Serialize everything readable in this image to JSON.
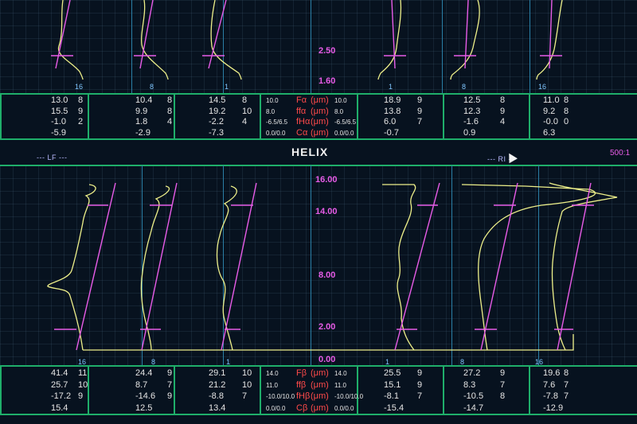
{
  "colors": {
    "background": "#07121f",
    "grid_line": "#1fae6a",
    "trace": "#eef08a",
    "reference": "#e85ce8",
    "marker": "#7fc6ff",
    "symbol": "#ff4a4a"
  },
  "profile": {
    "scale_upper": "2.50",
    "scale_lower": "1.60",
    "tooth_markers": [
      "16",
      "8",
      "1",
      "1",
      "8",
      "16"
    ],
    "rows": [
      {
        "l1": "13.0",
        "l1n": "8",
        "l2": "10.4",
        "l2n": "8",
        "l3": "14.5",
        "l3n": "8",
        "lt": "10.0",
        "sym": "Fα",
        "unit": "(μm)",
        "rt": "10.0",
        "r1": "18.9",
        "r1n": "9",
        "r2": "12.5",
        "r2n": "8",
        "r3": "11.0",
        "r3n": "8"
      },
      {
        "l1": "15.5",
        "l1n": "9",
        "l2": "9.9",
        "l2n": "8",
        "l3": "19.2",
        "l3n": "10",
        "lt": "8.0",
        "sym": "ffα",
        "unit": "(μm)",
        "rt": "8.0",
        "r1": "13.8",
        "r1n": "9",
        "r2": "12.3",
        "r2n": "9",
        "r3": "9.2",
        "r3n": "8"
      },
      {
        "l1": "-1.0",
        "l1n": "2",
        "l2": "1.8",
        "l2n": "4",
        "l3": "-2.2",
        "l3n": "4",
        "lt": "-6.5/6.5",
        "sym": "fHα",
        "unit": "(μm)",
        "rt": "-6.5/6.5",
        "r1": "6.0",
        "r1n": "7",
        "r2": "-1.6",
        "r2n": "4",
        "r3": "-0.0",
        "r3n": "0"
      },
      {
        "l1": "-5.9",
        "l1n": "",
        "l2": "-2.9",
        "l2n": "",
        "l3": "-7.3",
        "l3n": "",
        "lt": "0.0/0.0",
        "sym": "Cα",
        "unit": "(μm)",
        "rt": "0.0/0.0",
        "r1": "-0.7",
        "r1n": "",
        "r2": "0.9",
        "r2n": "",
        "r3": "6.3",
        "r3n": ""
      }
    ]
  },
  "helix": {
    "title": "HELIX",
    "left_label": "--- LF ---",
    "right_label": "--- RI ---",
    "ratio": "500:1",
    "scale": [
      "16.00",
      "14.00",
      "8.00",
      "2.00",
      "0.00"
    ],
    "tooth_markers": [
      "16",
      "8",
      "1",
      "1",
      "8",
      "16"
    ],
    "rows": [
      {
        "l1": "41.4",
        "l1n": "11",
        "l2": "24.4",
        "l2n": "9",
        "l3": "29.1",
        "l3n": "10",
        "lt": "14.0",
        "sym": "Fβ",
        "unit": "(μm)",
        "rt": "14.0",
        "r1": "25.5",
        "r1n": "9",
        "r2": "27.2",
        "r2n": "9",
        "r3": "19.6",
        "r3n": "8"
      },
      {
        "l1": "25.7",
        "l1n": "10",
        "l2": "8.7",
        "l2n": "7",
        "l3": "21.2",
        "l3n": "10",
        "lt": "11.0",
        "sym": "ffβ",
        "unit": "(μm)",
        "rt": "11.0",
        "r1": "15.1",
        "r1n": "9",
        "r2": "8.3",
        "r2n": "7",
        "r3": "7.6",
        "r3n": "7"
      },
      {
        "l1": "-17.2",
        "l1n": "9",
        "l2": "-14.6",
        "l2n": "9",
        "l3": "-8.8",
        "l3n": "7",
        "lt": "-10.0/10.0",
        "sym": "fHβ",
        "unit": "(μm)",
        "rt": "-10.0/10.0",
        "r1": "-8.1",
        "r1n": "7",
        "r2": "-10.5",
        "r2n": "8",
        "r3": "-7.8",
        "r3n": "7"
      },
      {
        "l1": "15.4",
        "l1n": "",
        "l2": "12.5",
        "l2n": "",
        "l3": "13.4",
        "l3n": "",
        "lt": "0.0/0.0",
        "sym": "Cβ",
        "unit": "(μm)",
        "rt": "0.0/0.0",
        "r1": "-15.4",
        "r1n": "",
        "r2": "-14.7",
        "r2n": "",
        "r3": "-12.9",
        "r3n": ""
      }
    ]
  }
}
